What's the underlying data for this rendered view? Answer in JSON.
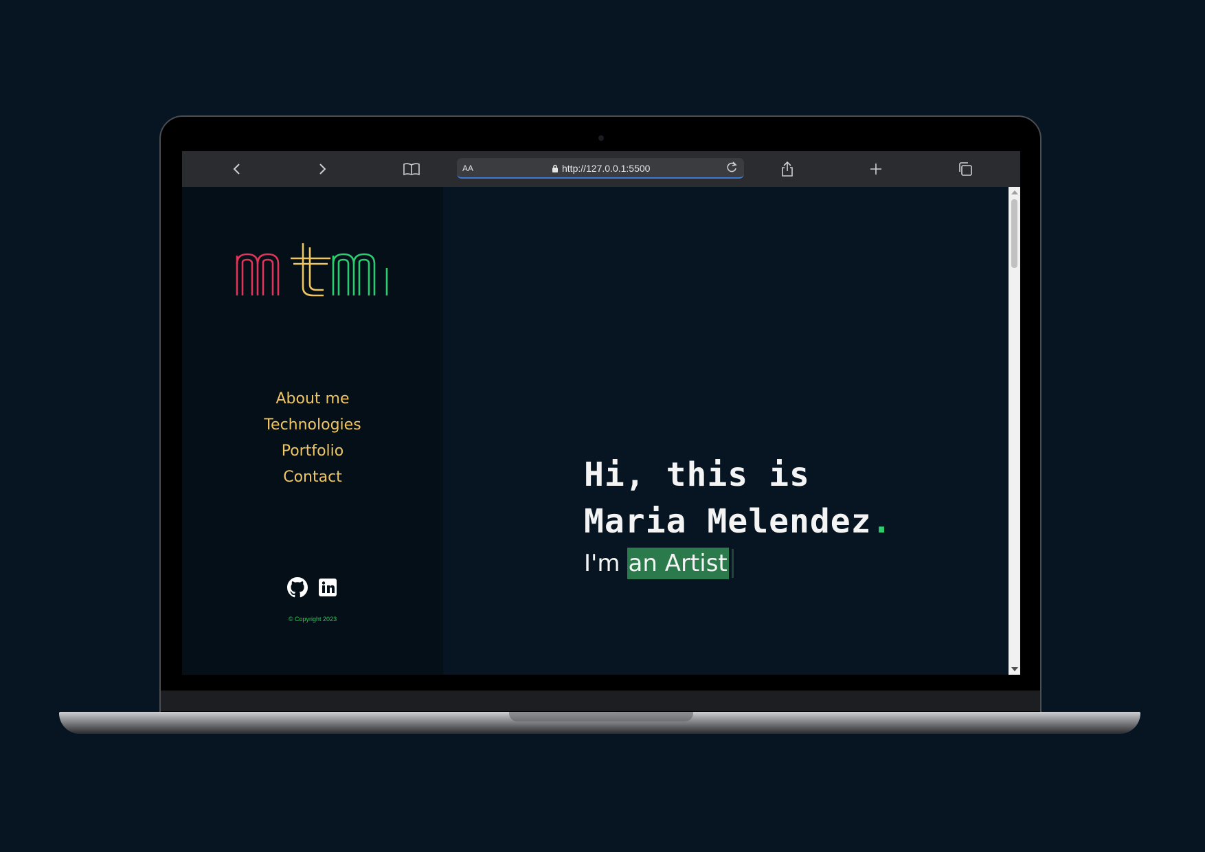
{
  "browser": {
    "text_size_label": "AA",
    "url": "http://127.0.0.1:5500",
    "icons": [
      "back-icon",
      "forward-icon",
      "bookmarks-icon",
      "lock-icon",
      "reload-icon",
      "share-icon",
      "new-tab-icon",
      "tabs-icon"
    ]
  },
  "sidebar": {
    "logo": "mtm",
    "nav": [
      {
        "label": "About me"
      },
      {
        "label": "Technologies"
      },
      {
        "label": "Portfolio"
      },
      {
        "label": "Contact"
      }
    ],
    "socials": [
      "github-icon",
      "linkedin-icon"
    ],
    "copyright": "© Copyright 2023"
  },
  "hero": {
    "line1": "Hi, this is",
    "line2": "Maria Melendez",
    "line2_dot": ".",
    "sub_prefix": "I'm",
    "sub_typed": "an Artist"
  },
  "colors": {
    "background": "#061521",
    "sidebar": "#050f17",
    "nav": "#f0c662",
    "accent_green": "#2ecc71",
    "typed_highlight": "#2b7a4b",
    "logo_red": "#e0345a",
    "logo_yellow": "#f0c662",
    "logo_green": "#2ecc71"
  }
}
